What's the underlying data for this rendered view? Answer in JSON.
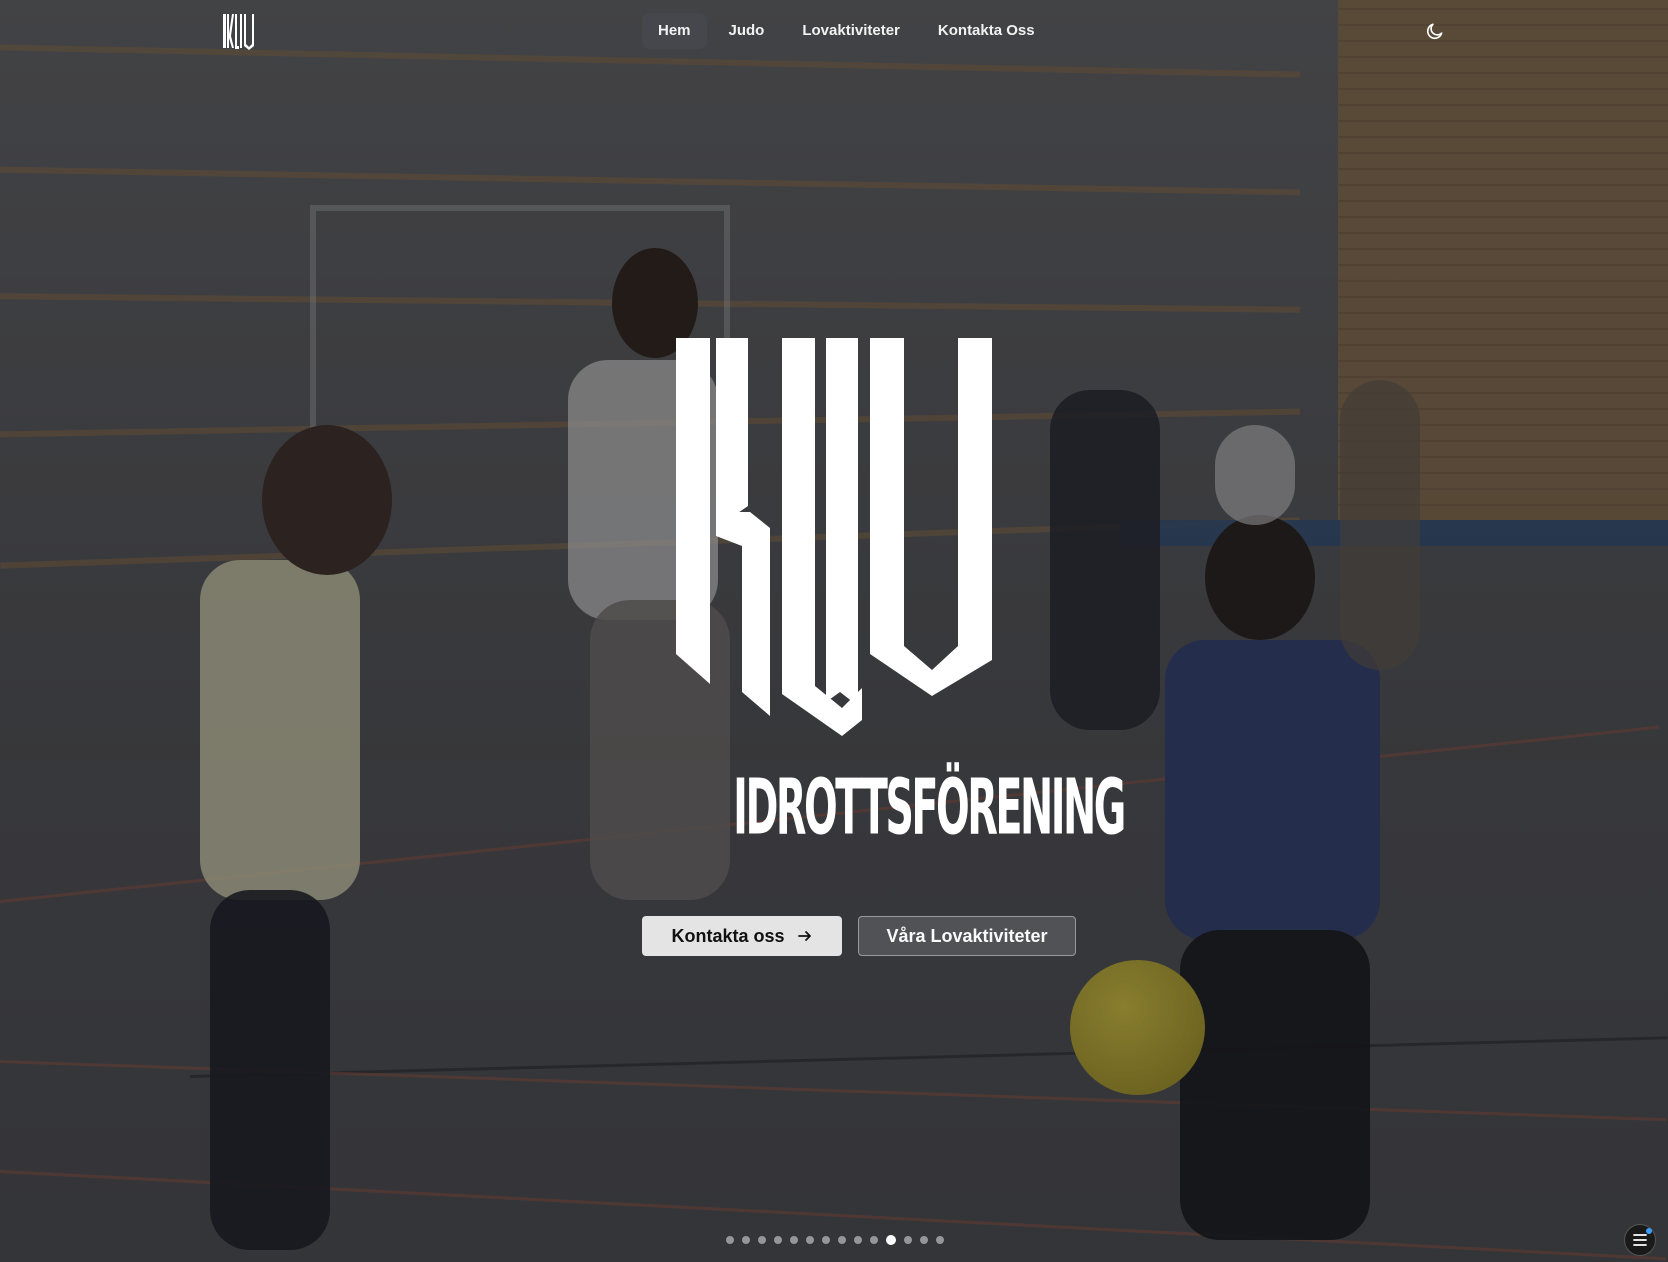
{
  "nav": {
    "items": [
      {
        "label": "Hem",
        "active": true
      },
      {
        "label": "Judo",
        "active": false
      },
      {
        "label": "Lovaktiviteter",
        "active": false
      },
      {
        "label": "Kontakta Oss",
        "active": false
      }
    ]
  },
  "theme_toggle": {
    "icon": "moon-icon"
  },
  "hero": {
    "logo_text": "KLIV",
    "subtitle": "IDROTTSFÖRENING",
    "primary_button": "Kontakta oss",
    "primary_button_icon": "arrow-right-icon",
    "secondary_button": "Våra Lovaktiviteter"
  },
  "carousel": {
    "total": 14,
    "active_index": 10
  },
  "menu_button": {
    "icon": "menu-icon"
  },
  "colors": {
    "text": "#ffffff",
    "primary_button_bg": "#e4e4e4",
    "active_nav_bg": "#46484e"
  }
}
